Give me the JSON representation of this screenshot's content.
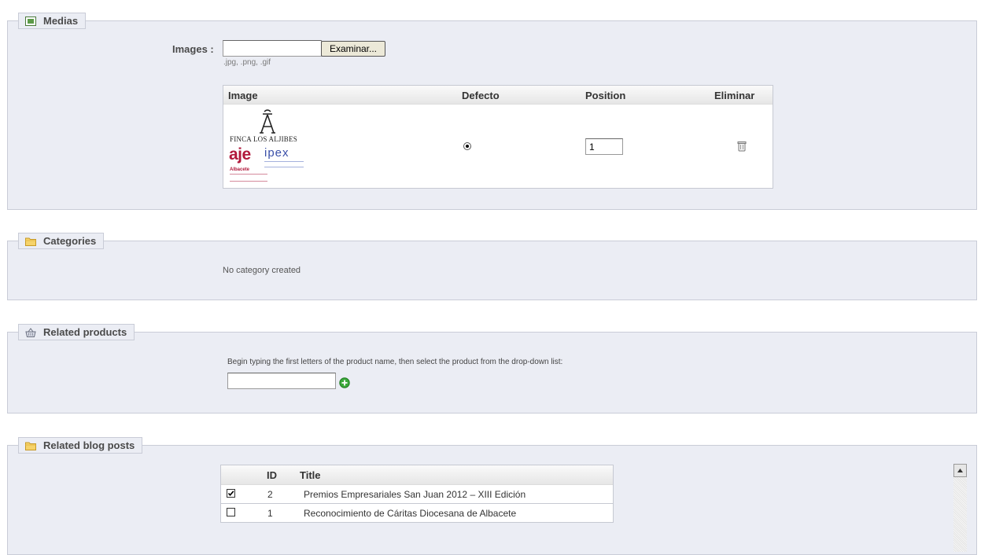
{
  "medias": {
    "legend": "Medias",
    "images_label": "Images :",
    "browse_button": "Examinar...",
    "file_value": "",
    "hint": ".jpg, .png, .gif",
    "table": {
      "headers": [
        "Image",
        "Defecto",
        "Position",
        "Eliminar"
      ],
      "rows": [
        {
          "logo_title": "FINCA LOS ALJIBES",
          "logo_aje": "aje",
          "logo_ipex": "ipex",
          "logo_city": "Albacete",
          "default_selected": true,
          "position": "1"
        }
      ]
    }
  },
  "categories": {
    "legend": "Categories",
    "empty_text": "No category created"
  },
  "related_products": {
    "legend": "Related products",
    "instructions": "Begin typing the first letters of the product name, then select the product from the drop-down list:",
    "input_value": ""
  },
  "related_blog_posts": {
    "legend": "Related blog posts",
    "headers": [
      "ID",
      "Title"
    ],
    "rows": [
      {
        "checked": true,
        "id": "2",
        "title": "Premios Empresariales San Juan 2012 – XIII Edición"
      },
      {
        "checked": false,
        "id": "1",
        "title": "Reconocimiento de Cáritas Diocesana de Albacete"
      }
    ]
  }
}
